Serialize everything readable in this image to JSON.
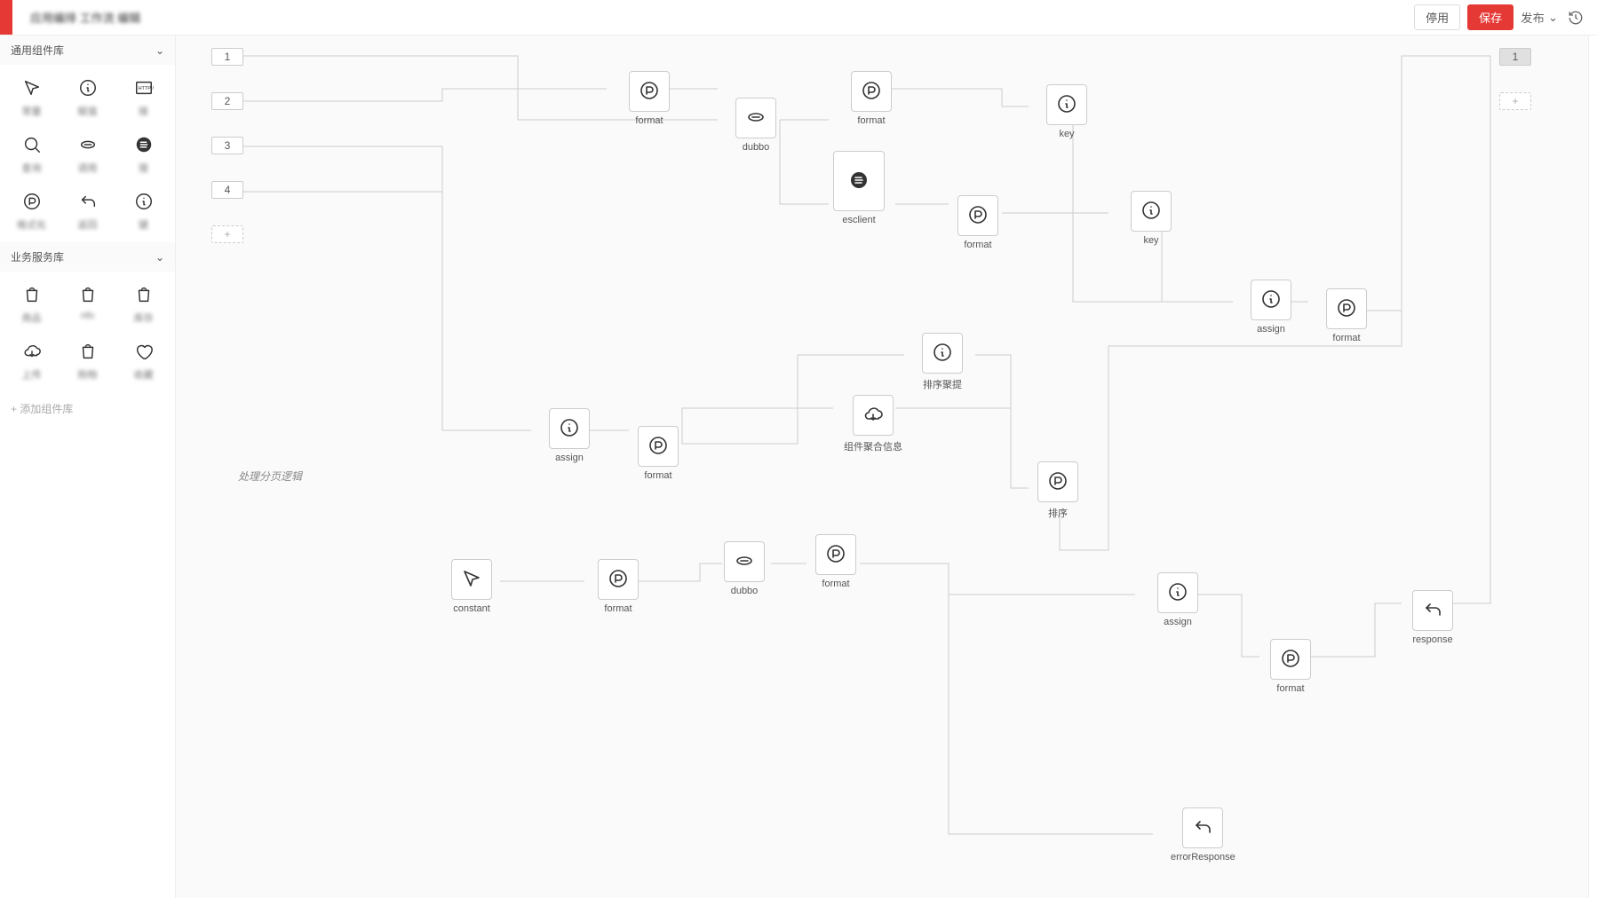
{
  "header": {
    "title": "应用编排 工作流 编辑",
    "stop": "停用",
    "save": "保存",
    "publish": "发布"
  },
  "sidebar": {
    "section1_title": "通用组件库",
    "section2_title": "业务服务库",
    "add_library": "+ 添加组件库",
    "components1": [
      {
        "icon": "cursor",
        "label": "常量"
      },
      {
        "icon": "info",
        "label": "赋值"
      },
      {
        "icon": "http",
        "label": "接"
      },
      {
        "icon": "search",
        "label": "查询"
      },
      {
        "icon": "link",
        "label": "调用"
      },
      {
        "icon": "eclient",
        "label": "搜"
      },
      {
        "icon": "format",
        "label": "格式化"
      },
      {
        "icon": "back",
        "label": "返回"
      },
      {
        "icon": "info",
        "label": "键"
      }
    ],
    "components2": [
      {
        "icon": "bag",
        "label": "商品"
      },
      {
        "icon": "bag",
        "label": "nfo"
      },
      {
        "icon": "bag",
        "label": "库存"
      },
      {
        "icon": "cloud",
        "label": "上传"
      },
      {
        "icon": "bag",
        "label": "购物"
      },
      {
        "icon": "heart",
        "label": "收藏"
      }
    ]
  },
  "canvas": {
    "inputs": [
      "1",
      "2",
      "3",
      "4"
    ],
    "outputs": [
      "1"
    ],
    "annotation": "处理分页逻辑",
    "nodes": {
      "format1": {
        "label": "format",
        "icon": "format"
      },
      "dubbo1": {
        "label": "dubbo",
        "icon": "link"
      },
      "format2": {
        "label": "format",
        "icon": "format"
      },
      "key1": {
        "label": "key",
        "icon": "info"
      },
      "esclient": {
        "label": "esclient",
        "icon": "eclient"
      },
      "format3": {
        "label": "format",
        "icon": "format"
      },
      "key2": {
        "label": "key",
        "icon": "info"
      },
      "assign1": {
        "label": "assign",
        "icon": "info"
      },
      "format4": {
        "label": "format",
        "icon": "format"
      },
      "assign2": {
        "label": "assign",
        "icon": "info"
      },
      "format5": {
        "label": "format",
        "icon": "format"
      },
      "sortAgg": {
        "label": "排序聚提",
        "icon": "info"
      },
      "compAgg": {
        "label": "组件聚合信息",
        "icon": "cloud"
      },
      "sort": {
        "label": "排序",
        "icon": "format"
      },
      "constant": {
        "label": "constant",
        "icon": "cursor"
      },
      "format6": {
        "label": "format",
        "icon": "format"
      },
      "dubbo2": {
        "label": "dubbo",
        "icon": "link"
      },
      "format7": {
        "label": "format",
        "icon": "format"
      },
      "assign3": {
        "label": "assign",
        "icon": "info"
      },
      "format8": {
        "label": "format",
        "icon": "format"
      },
      "response": {
        "label": "response",
        "icon": "back"
      },
      "errorResponse": {
        "label": "errorResponse",
        "icon": "back"
      }
    }
  }
}
